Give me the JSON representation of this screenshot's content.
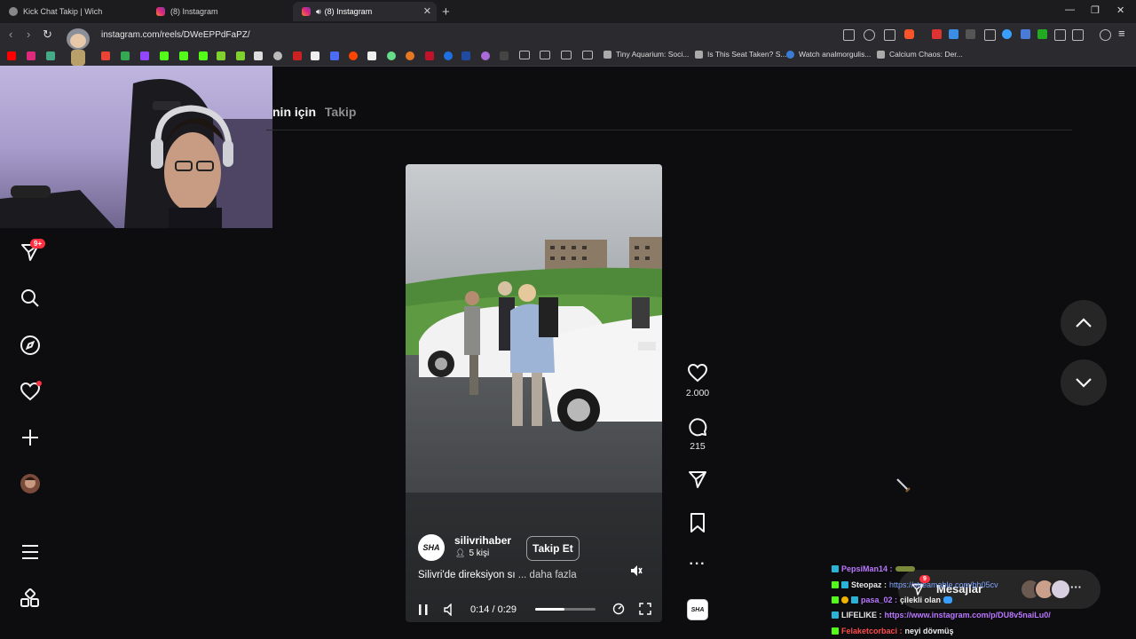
{
  "browser": {
    "tabs": [
      {
        "title": "Kick Chat Takip | Wich",
        "icon": "globe-icon"
      },
      {
        "title": "(8) Instagram",
        "icon": "instagram-icon"
      },
      {
        "title": "(8) Instagram",
        "icon": "instagram-icon",
        "active": true,
        "audio": "speaker-icon"
      }
    ],
    "url": "instagram.com/reels/DWeEPPdFaPZ/",
    "bookmarks": [
      "Tiny Aquarium: Soci...",
      "Is This Seat Taken? S...",
      "Watch analmorgulis...",
      "Calcium Chaos: Der..."
    ]
  },
  "instagram": {
    "feed_tabs": [
      "nin için",
      "Takip"
    ],
    "sidebar_badge": "9+",
    "reel": {
      "username": "silivrihaber",
      "avatar_text": "SHA",
      "followers": "5 kişi",
      "follow_label": "Takip Et",
      "caption": "Silivri'de direksiyon sı",
      "more_label": "... daha fazla",
      "time": "0:14 / 0:29",
      "progress_fraction": 0.48
    },
    "actions": {
      "likes": "2.000",
      "comments": "215",
      "audio_label": "SHA"
    }
  },
  "chat": {
    "messages": [
      {
        "user": "PepsiMan14 :",
        "text": "",
        "color": "#b978ff"
      },
      {
        "user": "Steopaz :",
        "text": "https://streamable.com/bh05cv",
        "color": "#e8e8e8",
        "link": true
      },
      {
        "user": "pasa_02 :",
        "text": "çilekli olan",
        "color": "#b978ff"
      },
      {
        "user": "LIFELIKE :",
        "text": "https://www.instagram.com/p/DU8v5naiLu0/",
        "color": "#e8e8e8",
        "link": true
      },
      {
        "user": "Felaketcorbaci :",
        "text": "neyi dövmüş",
        "color": "#ff4a4a"
      }
    ],
    "messages_label": "Mesajlar",
    "messages_badge": "9"
  }
}
